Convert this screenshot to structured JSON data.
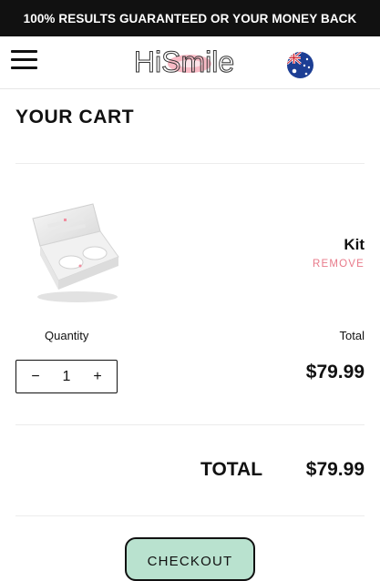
{
  "promo_banner": {
    "text": "100% RESULTS GUARANTEED OR YOUR MONEY BACK"
  },
  "header": {
    "menu_icon": "hamburger-menu-icon",
    "logo_text": "HiSmile",
    "flag_icon": "australia-flag-icon"
  },
  "cart": {
    "title": "YOUR CART",
    "item": {
      "name": "Kit",
      "remove_label": "REMOVE",
      "quantity_label": "Quantity",
      "total_label": "Total",
      "quantity": "1",
      "decrement_label": "−",
      "increment_label": "+",
      "line_total": "$79.99"
    },
    "grand_total_label": "TOTAL",
    "grand_total_value": "$79.99",
    "checkout_label": "CHECKOUT"
  },
  "colors": {
    "banner_bg": "#111111",
    "remove_text": "#e87a8a",
    "checkout_bg": "#b9e2cf",
    "logo_pink": "#f5a3b2"
  }
}
